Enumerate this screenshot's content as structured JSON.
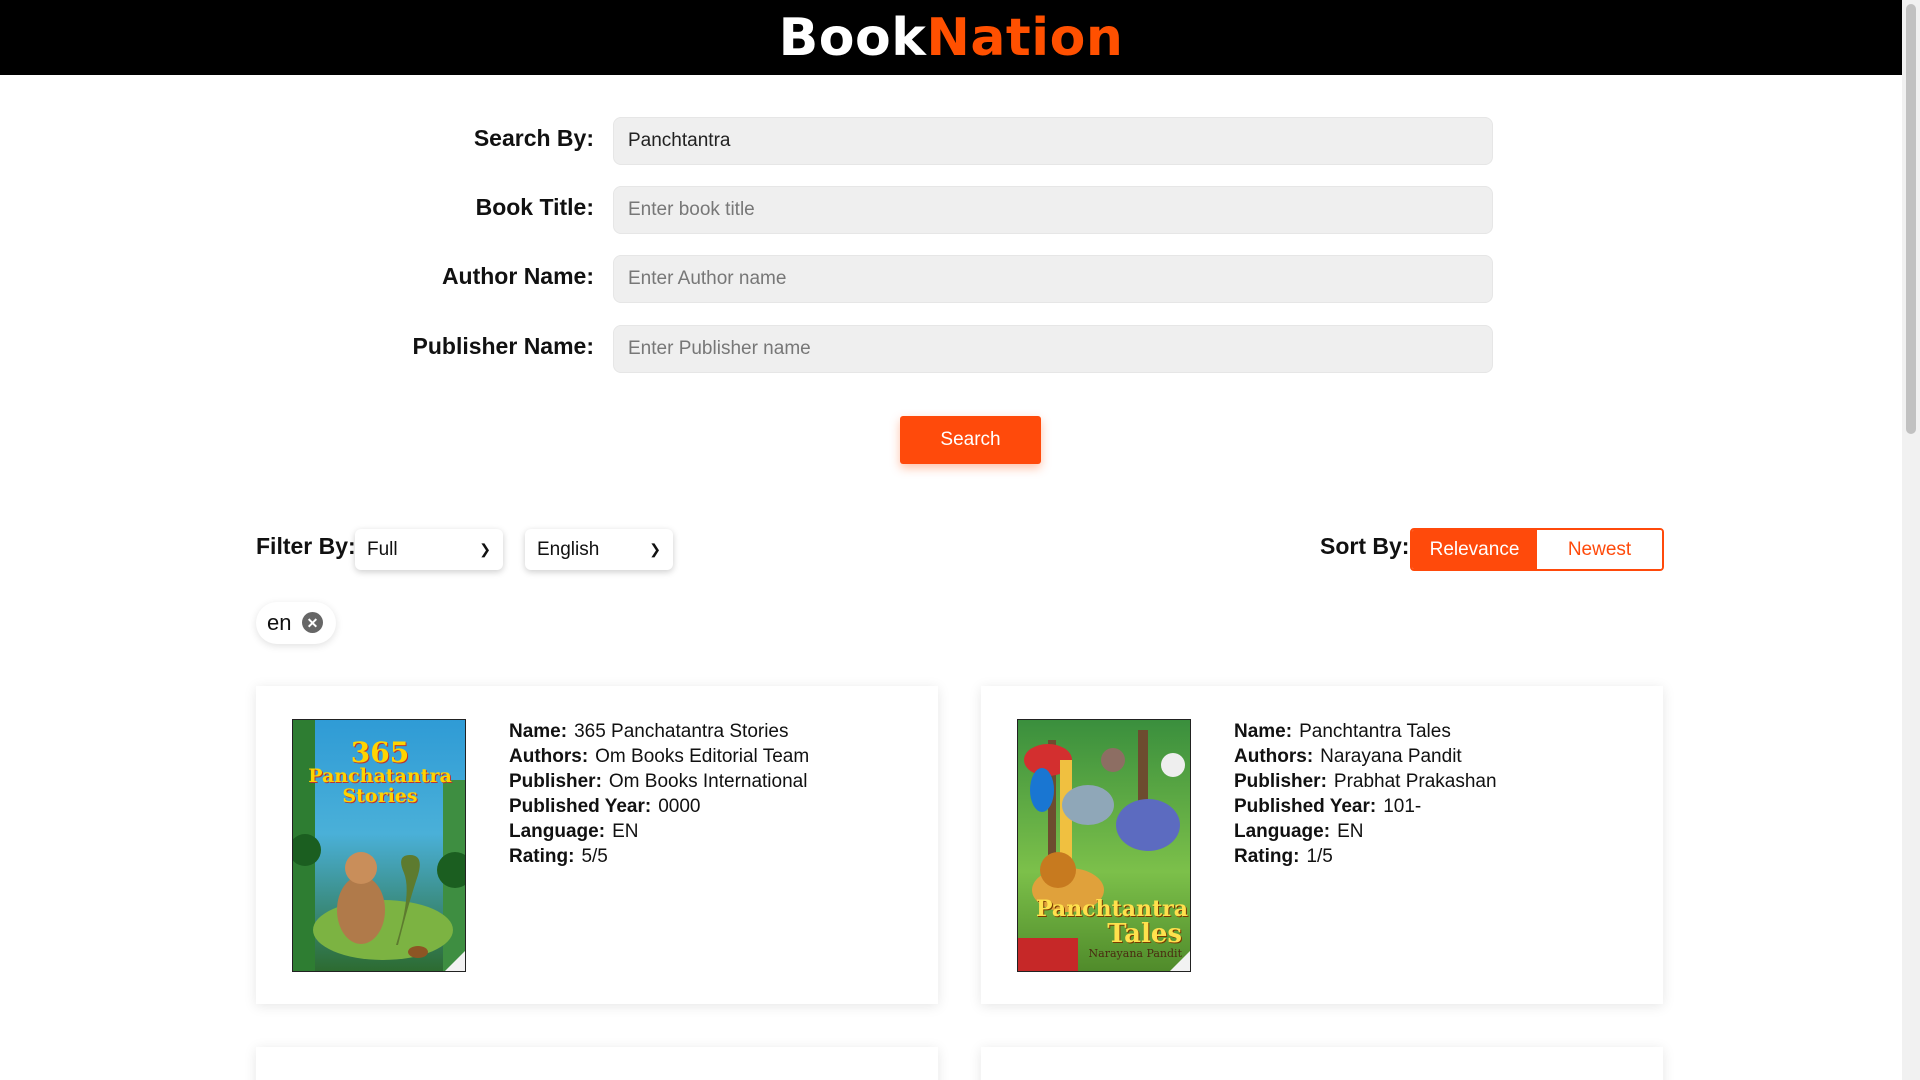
{
  "brand": {
    "part1": "Book",
    "part2": "Nation",
    "accent": "#ff4a0b"
  },
  "search_form": {
    "search_by": {
      "label": "Search By:",
      "value": "Panchtantra",
      "placeholder": ""
    },
    "book_title": {
      "label": "Book Title:",
      "value": "",
      "placeholder": "Enter book title"
    },
    "author_name": {
      "label": "Author Name:",
      "value": "",
      "placeholder": "Enter Author name"
    },
    "publisher_name": {
      "label": "Publisher Name:",
      "value": "",
      "placeholder": "Enter Publisher name"
    },
    "search_button": "Search"
  },
  "filters": {
    "label": "Filter By:",
    "filter_type": "Full",
    "language": "English"
  },
  "sort": {
    "label": "Sort By:",
    "options": [
      "Relevance",
      "Newest"
    ],
    "selected": "Relevance"
  },
  "active_chip": {
    "label": "en",
    "remove_icon": "close-circle-icon"
  },
  "field_labels": {
    "name": "Name:",
    "authors": "Authors:",
    "publisher": "Publisher:",
    "year": "Published Year:",
    "language": "Language:",
    "rating": "Rating:"
  },
  "books": [
    {
      "name": "365 Panchatantra Stories",
      "authors": "Om Books Editorial Team",
      "publisher": "Om Books International",
      "year": "0000",
      "language": "EN",
      "rating": "5/5",
      "cover_text": [
        "365",
        "Panchatantra",
        "Stories"
      ]
    },
    {
      "name": "Panchtantra Tales",
      "authors": "Narayana Pandit",
      "publisher": "Prabhat Prakashan",
      "year": "101-",
      "language": "EN",
      "rating": "1/5",
      "cover_text": [
        "Panchtantra",
        "Tales",
        "Narayana Pandit"
      ]
    }
  ]
}
